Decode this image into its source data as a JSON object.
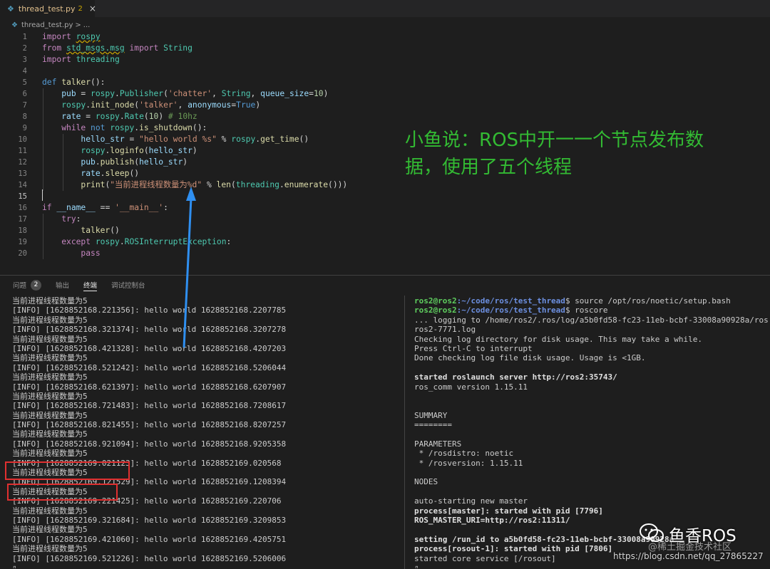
{
  "tab": {
    "icon": "python-file-icon",
    "filename": "thread_test.py",
    "problems": "2",
    "close": "×"
  },
  "breadcrumb": {
    "file": "thread_test.py",
    "separator": ">",
    "more": "..."
  },
  "editor": {
    "line_numbers": [
      "1",
      "2",
      "3",
      "4",
      "5",
      "6",
      "7",
      "8",
      "9",
      "10",
      "11",
      "12",
      "13",
      "14",
      "15",
      "16",
      "17",
      "18",
      "19",
      "20"
    ],
    "active_line": "15",
    "lines": [
      "import rospy",
      "from std_msgs.msg import String",
      "import threading",
      "",
      "def talker():",
      "    pub = rospy.Publisher('chatter', String, queue_size=10)",
      "    rospy.init_node('talker', anonymous=True)",
      "    rate = rospy.Rate(10) # 10hz",
      "    while not rospy.is_shutdown():",
      "        hello_str = \"hello world %s\" % rospy.get_time()",
      "        rospy.loginfo(hello_str)",
      "        pub.publish(hello_str)",
      "        rate.sleep()",
      "        print(\"当前进程线程数量为%d\" % len(threading.enumerate()))",
      "",
      "if __name__ == '__main__':",
      "    try:",
      "        talker()",
      "    except rospy.ROSInterruptException:",
      "        pass"
    ]
  },
  "annotation": {
    "text": "小鱼说：ROS中开一一个节点发布数据，使用了五个线程",
    "color": "#33bb33"
  },
  "panel": {
    "tabs": [
      "问题",
      "输出",
      "终端",
      "调试控制台"
    ],
    "problems_count": "2",
    "active_tab": "终端"
  },
  "terminal_left": [
    "当前进程线程数量为5",
    "[INFO] [1628852168.221356]: hello world 1628852168.2207785",
    "当前进程线程数量为5",
    "[INFO] [1628852168.321374]: hello world 1628852168.3207278",
    "当前进程线程数量为5",
    "[INFO] [1628852168.421328]: hello world 1628852168.4207203",
    "当前进程线程数量为5",
    "[INFO] [1628852168.521242]: hello world 1628852168.5206044",
    "当前进程线程数量为5",
    "[INFO] [1628852168.621397]: hello world 1628852168.6207907",
    "当前进程线程数量为5",
    "[INFO] [1628852168.721483]: hello world 1628852168.7208617",
    "当前进程线程数量为5",
    "[INFO] [1628852168.821455]: hello world 1628852168.8207257",
    "当前进程线程数量为5",
    "[INFO] [1628852168.921094]: hello world 1628852168.9205358",
    "当前进程线程数量为5",
    "[INFO] [1628852169.021123]: hello world 1628852169.020568",
    "当前进程线程数量为5",
    "[INFO] [1628852169.121529]: hello world 1628852169.1208394",
    "当前进程线程数量为5",
    "[INFO] [1628852169.221425]: hello world 1628852169.220706",
    "当前进程线程数量为5",
    "[INFO] [1628852169.321684]: hello world 1628852169.3209853",
    "当前进程线程数量为5",
    "[INFO] [1628852169.421060]: hello world 1628852169.4205751",
    "当前进程线程数量为5",
    "[INFO] [1628852169.521226]: hello world 1628852169.5206006",
    "▯"
  ],
  "terminal_right": {
    "prompt_user": "ros2@ros2",
    "prompt_path": ":~/code/ros/test_thread",
    "prompt_symbol": "$",
    "command_1": " source /opt/ros/noetic/setup.bash",
    "command_2": " roscore",
    "output": [
      "... logging to /home/ros2/.ros/log/a5b0fd58-fc23-11eb-bcbf-33008a90928a/ros",
      "ros2-7771.log",
      "Checking log directory for disk usage. This may take a while.",
      "Press Ctrl-C to interrupt",
      "Done checking log file disk usage. Usage is <1GB.",
      "",
      "started roslaunch server http://ros2:35743/",
      "ros_comm version 1.15.11",
      "",
      "",
      "SUMMARY",
      "========",
      "",
      "PARAMETERS",
      " * /rosdistro: noetic",
      " * /rosversion: 1.15.11",
      "",
      "NODES",
      "",
      "auto-starting new master",
      "process[master]: started with pid [7796]",
      "ROS_MASTER_URI=http://ros2:11311/",
      "",
      "setting /run_id to a5b0fd58-fc23-11eb-bcbf-33008a90928a",
      "process[rosout-1]: started with pid [7806]",
      "started core service [/rosout]",
      "▯"
    ]
  },
  "watermark": {
    "brand": "鱼香ROS",
    "community": "@稀土掘金技术社区",
    "url": "https://blog.csdn.net/qq_27865227",
    "icon": "wechat-icon"
  }
}
